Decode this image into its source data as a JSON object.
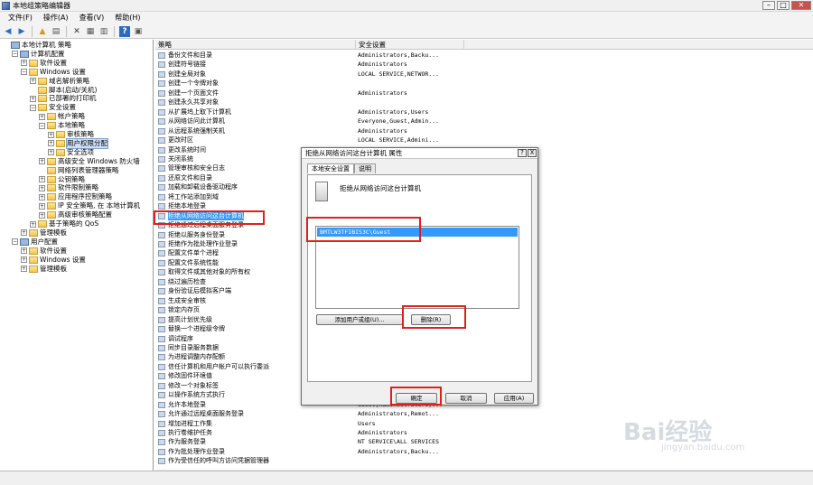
{
  "window": {
    "title": "本地组策略编辑器"
  },
  "menu": [
    "文件(F)",
    "操作(A)",
    "查看(V)",
    "帮助(H)"
  ],
  "tree": {
    "items": [
      {
        "label": "本地计算机 策略",
        "indent": 0,
        "icon": "pc",
        "exp": ""
      },
      {
        "label": "计算机配置",
        "indent": 1,
        "icon": "pc",
        "exp": "−"
      },
      {
        "label": "软件设置",
        "indent": 2,
        "icon": "folder",
        "exp": "+"
      },
      {
        "label": "Windows 设置",
        "indent": 2,
        "icon": "folder",
        "exp": "−"
      },
      {
        "label": "域名解析策略",
        "indent": 3,
        "icon": "folder",
        "exp": "+"
      },
      {
        "label": "脚本(启动/关机)",
        "indent": 3,
        "icon": "folder",
        "exp": ""
      },
      {
        "label": "已部署的打印机",
        "indent": 3,
        "icon": "folder",
        "exp": "+"
      },
      {
        "label": "安全设置",
        "indent": 3,
        "icon": "folder",
        "exp": "−"
      },
      {
        "label": "帐户策略",
        "indent": 4,
        "icon": "folder",
        "exp": "+"
      },
      {
        "label": "本地策略",
        "indent": 4,
        "icon": "folder",
        "exp": "−"
      },
      {
        "label": "审核策略",
        "indent": 5,
        "icon": "folder",
        "exp": "+"
      },
      {
        "label": "用户权限分配",
        "indent": 5,
        "icon": "folder",
        "exp": "+",
        "selected": true
      },
      {
        "label": "安全选项",
        "indent": 5,
        "icon": "folder",
        "exp": "+"
      },
      {
        "label": "高级安全 Windows 防火墙",
        "indent": 4,
        "icon": "folder",
        "exp": "+"
      },
      {
        "label": "网络列表管理器策略",
        "indent": 4,
        "icon": "folder",
        "exp": ""
      },
      {
        "label": "公钥策略",
        "indent": 4,
        "icon": "folder",
        "exp": "+"
      },
      {
        "label": "软件限制策略",
        "indent": 4,
        "icon": "folder",
        "exp": "+"
      },
      {
        "label": "应用程序控制策略",
        "indent": 4,
        "icon": "folder",
        "exp": "+"
      },
      {
        "label": "IP 安全策略, 在 本地计算机",
        "indent": 4,
        "icon": "folder",
        "exp": "+"
      },
      {
        "label": "高级审核策略配置",
        "indent": 4,
        "icon": "folder",
        "exp": "+"
      },
      {
        "label": "基于策略的 QoS",
        "indent": 3,
        "icon": "folder",
        "exp": "+"
      },
      {
        "label": "管理模板",
        "indent": 2,
        "icon": "folder",
        "exp": "+"
      },
      {
        "label": "用户配置",
        "indent": 1,
        "icon": "pc",
        "exp": "−"
      },
      {
        "label": "软件设置",
        "indent": 2,
        "icon": "folder",
        "exp": "+"
      },
      {
        "label": "Windows 设置",
        "indent": 2,
        "icon": "folder",
        "exp": "+"
      },
      {
        "label": "管理模板",
        "indent": 2,
        "icon": "folder",
        "exp": "+"
      }
    ]
  },
  "list": {
    "columns": [
      "策略",
      "安全设置"
    ],
    "rows": [
      {
        "policy": "备份文件和目录",
        "setting": "Administrators,Backu..."
      },
      {
        "policy": "创建符号链接",
        "setting": "Administrators"
      },
      {
        "policy": "创建全局对象",
        "setting": "LOCAL SERVICE,NETWOR..."
      },
      {
        "policy": "创建一个令牌对象",
        "setting": ""
      },
      {
        "policy": "创建一个页面文件",
        "setting": "Administrators"
      },
      {
        "policy": "创建永久共享对象",
        "setting": ""
      },
      {
        "policy": "从扩展坞上取下计算机",
        "setting": "Administrators,Users"
      },
      {
        "policy": "从网络访问此计算机",
        "setting": "Everyone,Guest,Admin..."
      },
      {
        "policy": "从远程系统强制关机",
        "setting": "Administrators"
      },
      {
        "policy": "更改时区",
        "setting": "LOCAL SERVICE,Admini..."
      },
      {
        "policy": "更改系统时间",
        "setting": ""
      },
      {
        "policy": "关闭系统",
        "setting": ""
      },
      {
        "policy": "管理审核和安全日志",
        "setting": ""
      },
      {
        "policy": "还原文件和目录",
        "setting": ""
      },
      {
        "policy": "加载和卸载设备驱动程序",
        "setting": ""
      },
      {
        "policy": "将工作站添加到域",
        "setting": ""
      },
      {
        "policy": "拒绝本地登录",
        "setting": ""
      },
      {
        "policy": "拒绝从网络访问这台计算机",
        "setting": "",
        "selected": true
      },
      {
        "policy": "拒绝通过远程桌面服务登录",
        "setting": ""
      },
      {
        "policy": "拒绝以服务身份登录",
        "setting": ""
      },
      {
        "policy": "拒绝作为批处理作业登录",
        "setting": ""
      },
      {
        "policy": "配置文件单个进程",
        "setting": ""
      },
      {
        "policy": "配置文件系统性能",
        "setting": ""
      },
      {
        "policy": "取得文件或其他对象的所有权",
        "setting": ""
      },
      {
        "policy": "绕过遍历检查",
        "setting": ""
      },
      {
        "policy": "身份验证后模拟客户端",
        "setting": ""
      },
      {
        "policy": "生成安全审核",
        "setting": ""
      },
      {
        "policy": "锁定内存页",
        "setting": ""
      },
      {
        "policy": "提高计划优先级",
        "setting": ""
      },
      {
        "policy": "替换一个进程级令牌",
        "setting": ""
      },
      {
        "policy": "调试程序",
        "setting": ""
      },
      {
        "policy": "同步目录服务数据",
        "setting": ""
      },
      {
        "policy": "为进程调整内存配额",
        "setting": ""
      },
      {
        "policy": "信任计算机和用户帐户可以执行委派",
        "setting": ""
      },
      {
        "policy": "修改固件环境值",
        "setting": ""
      },
      {
        "policy": "修改一个对象标签",
        "setting": ""
      },
      {
        "policy": "以操作系统方式执行",
        "setting": ""
      },
      {
        "policy": "允许本地登录",
        "setting": "Guest,Administrators,..."
      },
      {
        "policy": "允许通过远程桌面服务登录",
        "setting": "Administrators,Remot..."
      },
      {
        "policy": "增加进程工作集",
        "setting": "Users"
      },
      {
        "policy": "执行卷维护任务",
        "setting": "Administrators"
      },
      {
        "policy": "作为服务登录",
        "setting": "NT SERVICE\\ALL SERVICES"
      },
      {
        "policy": "作为批处理作业登录",
        "setting": "Administrators,Backu..."
      },
      {
        "policy": "作为受信任的呼叫方访问凭据管理器",
        "setting": ""
      }
    ]
  },
  "dialog": {
    "title": "拒绝从网络访问这台计算机 属性",
    "help": "?",
    "close": "X",
    "tabs": [
      "本地安全设置",
      "说明"
    ],
    "policy_name": "拒绝从网络访问这台计算机",
    "members": [
      "BMTLW3TFIBIS3C\\Guest"
    ],
    "add_button": "添加用户或组(U)...",
    "remove_button": "删除(R)",
    "ok_button": "确定",
    "cancel_button": "取消",
    "apply_button": "应用(A)"
  },
  "watermark": {
    "brand": "Bai经验",
    "url": "jingyan.baidu.com"
  }
}
